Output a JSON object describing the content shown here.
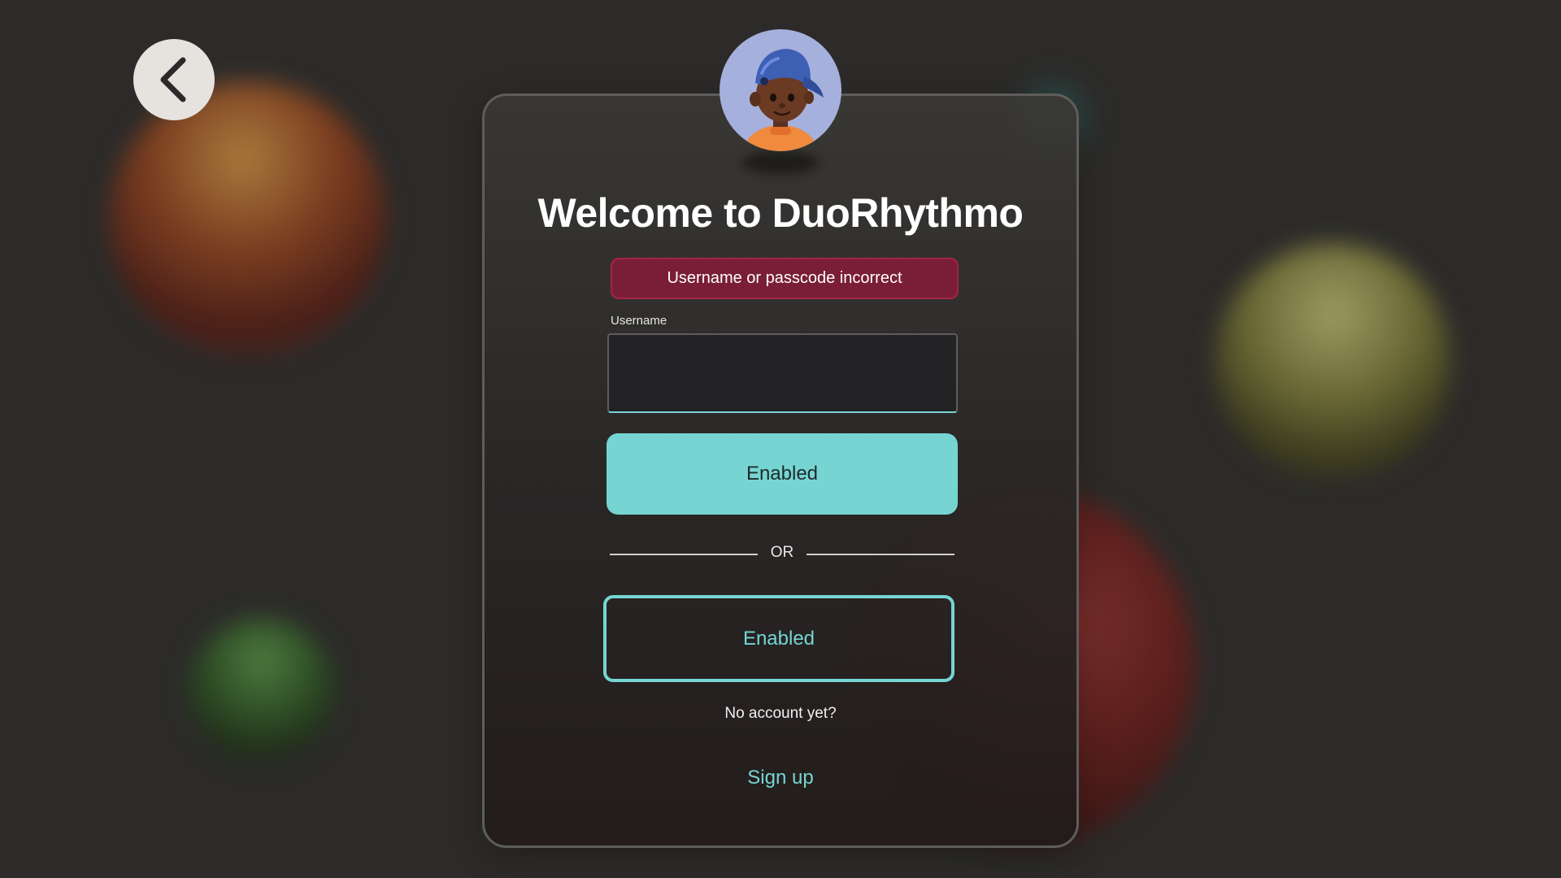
{
  "back_button": {
    "icon": "chevron-left-icon"
  },
  "avatar": {
    "icon": "avatar-cap-boy-icon"
  },
  "login": {
    "title": "Welcome to DuoRhythmo",
    "error_message": "Username or passcode incorrect",
    "username_label": "Username",
    "username_value": "",
    "primary_button_label": "Enabled",
    "divider_text": "OR",
    "secondary_button_label": "Enabled",
    "no_account_text": "No account yet?",
    "signup_label": "Sign up"
  },
  "colors": {
    "background": "#2c2b29",
    "accent": "#76d5d3",
    "error": "#7a1e36"
  }
}
